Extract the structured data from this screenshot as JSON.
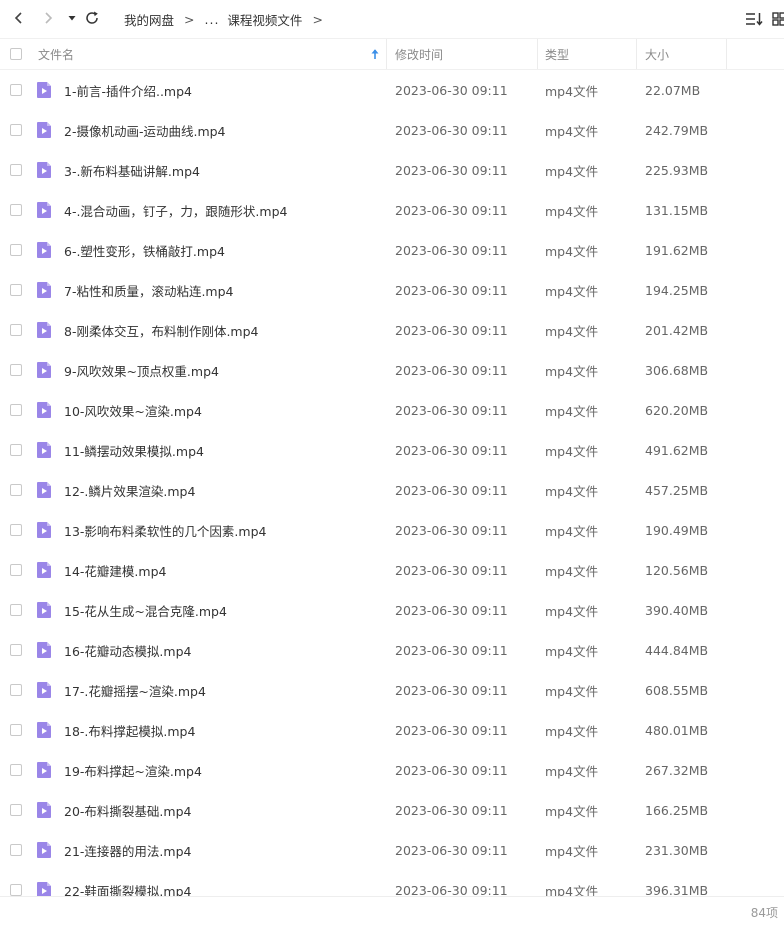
{
  "breadcrumb": {
    "root": "我的网盘",
    "ellipsis": "...",
    "current": "课程视频文件",
    "separator": ">"
  },
  "icons": {
    "back": "chevron-left-icon",
    "forward": "chevron-right-icon",
    "history": "caret-down-icon",
    "refresh": "refresh-icon",
    "sort": "sort-list-icon",
    "view": "grid-view-icon",
    "file": "video-file-icon"
  },
  "colors": {
    "file_icon": "#9a86e8",
    "sort_arrow": "#3b8fe8"
  },
  "columns": {
    "name": "文件名",
    "modified": "修改时间",
    "type": "类型",
    "size": "大小"
  },
  "files": [
    {
      "name": "1-前言-插件介绍..mp4",
      "modified": "2023-06-30 09:11",
      "type": "mp4文件",
      "size": "22.07MB"
    },
    {
      "name": "2-摄像机动画-运动曲线.mp4",
      "modified": "2023-06-30 09:11",
      "type": "mp4文件",
      "size": "242.79MB"
    },
    {
      "name": "3-.新布料基础讲解.mp4",
      "modified": "2023-06-30 09:11",
      "type": "mp4文件",
      "size": "225.93MB"
    },
    {
      "name": "4-.混合动画，钉子，力，跟随形状.mp4",
      "modified": "2023-06-30 09:11",
      "type": "mp4文件",
      "size": "131.15MB"
    },
    {
      "name": "6-.塑性变形，铁桶敲打.mp4",
      "modified": "2023-06-30 09:11",
      "type": "mp4文件",
      "size": "191.62MB"
    },
    {
      "name": "7-粘性和质量，滚动粘连.mp4",
      "modified": "2023-06-30 09:11",
      "type": "mp4文件",
      "size": "194.25MB"
    },
    {
      "name": "8-刚柔体交互，布料制作刚体.mp4",
      "modified": "2023-06-30 09:11",
      "type": "mp4文件",
      "size": "201.42MB"
    },
    {
      "name": "9-风吹效果~顶点权重.mp4",
      "modified": "2023-06-30 09:11",
      "type": "mp4文件",
      "size": "306.68MB"
    },
    {
      "name": "10-风吹效果~渲染.mp4",
      "modified": "2023-06-30 09:11",
      "type": "mp4文件",
      "size": "620.20MB"
    },
    {
      "name": "11-鳞摆动效果模拟.mp4",
      "modified": "2023-06-30 09:11",
      "type": "mp4文件",
      "size": "491.62MB"
    },
    {
      "name": "12-.鳞片效果渲染.mp4",
      "modified": "2023-06-30 09:11",
      "type": "mp4文件",
      "size": "457.25MB"
    },
    {
      "name": "13-影响布料柔软性的几个因素.mp4",
      "modified": "2023-06-30 09:11",
      "type": "mp4文件",
      "size": "190.49MB"
    },
    {
      "name": "14-花瓣建模.mp4",
      "modified": "2023-06-30 09:11",
      "type": "mp4文件",
      "size": "120.56MB"
    },
    {
      "name": "15-花从生成~混合克隆.mp4",
      "modified": "2023-06-30 09:11",
      "type": "mp4文件",
      "size": "390.40MB"
    },
    {
      "name": "16-花瓣动态模拟.mp4",
      "modified": "2023-06-30 09:11",
      "type": "mp4文件",
      "size": "444.84MB"
    },
    {
      "name": "17-.花瓣摇摆~渲染.mp4",
      "modified": "2023-06-30 09:11",
      "type": "mp4文件",
      "size": "608.55MB"
    },
    {
      "name": "18-.布料撑起模拟.mp4",
      "modified": "2023-06-30 09:11",
      "type": "mp4文件",
      "size": "480.01MB"
    },
    {
      "name": "19-布料撑起~渲染.mp4",
      "modified": "2023-06-30 09:11",
      "type": "mp4文件",
      "size": "267.32MB"
    },
    {
      "name": "20-布料撕裂基础.mp4",
      "modified": "2023-06-30 09:11",
      "type": "mp4文件",
      "size": "166.25MB"
    },
    {
      "name": "21-连接器的用法.mp4",
      "modified": "2023-06-30 09:11",
      "type": "mp4文件",
      "size": "231.30MB"
    },
    {
      "name": "22-鞋面撕裂模拟.mp4",
      "modified": "2023-06-30 09:11",
      "type": "mp4文件",
      "size": "396.31MB"
    }
  ],
  "footer": {
    "count": "84项"
  }
}
